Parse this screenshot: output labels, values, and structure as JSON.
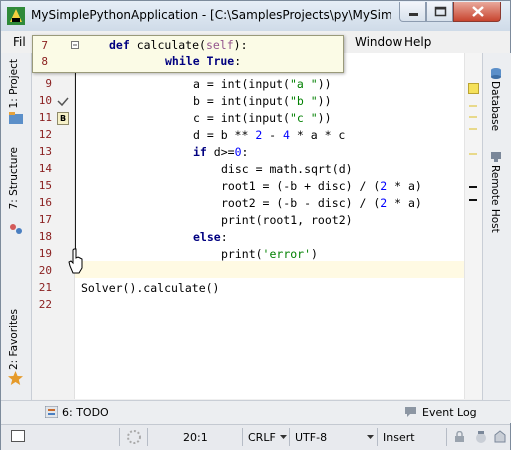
{
  "window": {
    "title": "MySimplePythonApplication - [C:\\SamplesProjects\\py\\MySimplePyt..."
  },
  "menu": {
    "items": [
      {
        "label": "File",
        "display": "Fil"
      },
      {
        "label": "Window"
      },
      {
        "label": "Help"
      }
    ]
  },
  "left_tabs": {
    "project": "1: Project",
    "structure": "7: Structure",
    "favorites": "2: Favorites"
  },
  "right_tabs": {
    "database": "Database",
    "remote_host": "Remote Host"
  },
  "popup": {
    "lines": [
      {
        "num": "7",
        "code": "def calculate(self):"
      },
      {
        "num": "8",
        "code": "while True:"
      }
    ]
  },
  "editor": {
    "line_numbers": [
      "9",
      "10",
      "11",
      "12",
      "13",
      "14",
      "15",
      "16",
      "17",
      "18",
      "19",
      "20",
      "21",
      "22"
    ],
    "lines": [
      "a = int(input(\"a \"))",
      "b = int(input(\"b \"))",
      "c = int(input(\"c \"))",
      "d = b ** 2 - 4 * a * c",
      "if d>=0:",
      "disc = math.sqrt(d)",
      "root1 = (-b + disc) / (2 * a)",
      "root2 = (-b - disc) / (2 * a)",
      "print(root1, root2)",
      "else:",
      "print('error')",
      "",
      "Solver().calculate()",
      ""
    ],
    "gutter_badge": "B"
  },
  "bottom_tools": {
    "todo": "6: TODO",
    "event_log": "Event Log"
  },
  "status": {
    "position": "20:1",
    "line_separator": "CRLF",
    "encoding": "UTF-8",
    "insert_mode": "Insert"
  },
  "colors": {
    "keyword": "#000080",
    "string": "#008000",
    "number": "#0000ff",
    "line_number": "#8a1f1f",
    "current_line": "#fffae3"
  }
}
